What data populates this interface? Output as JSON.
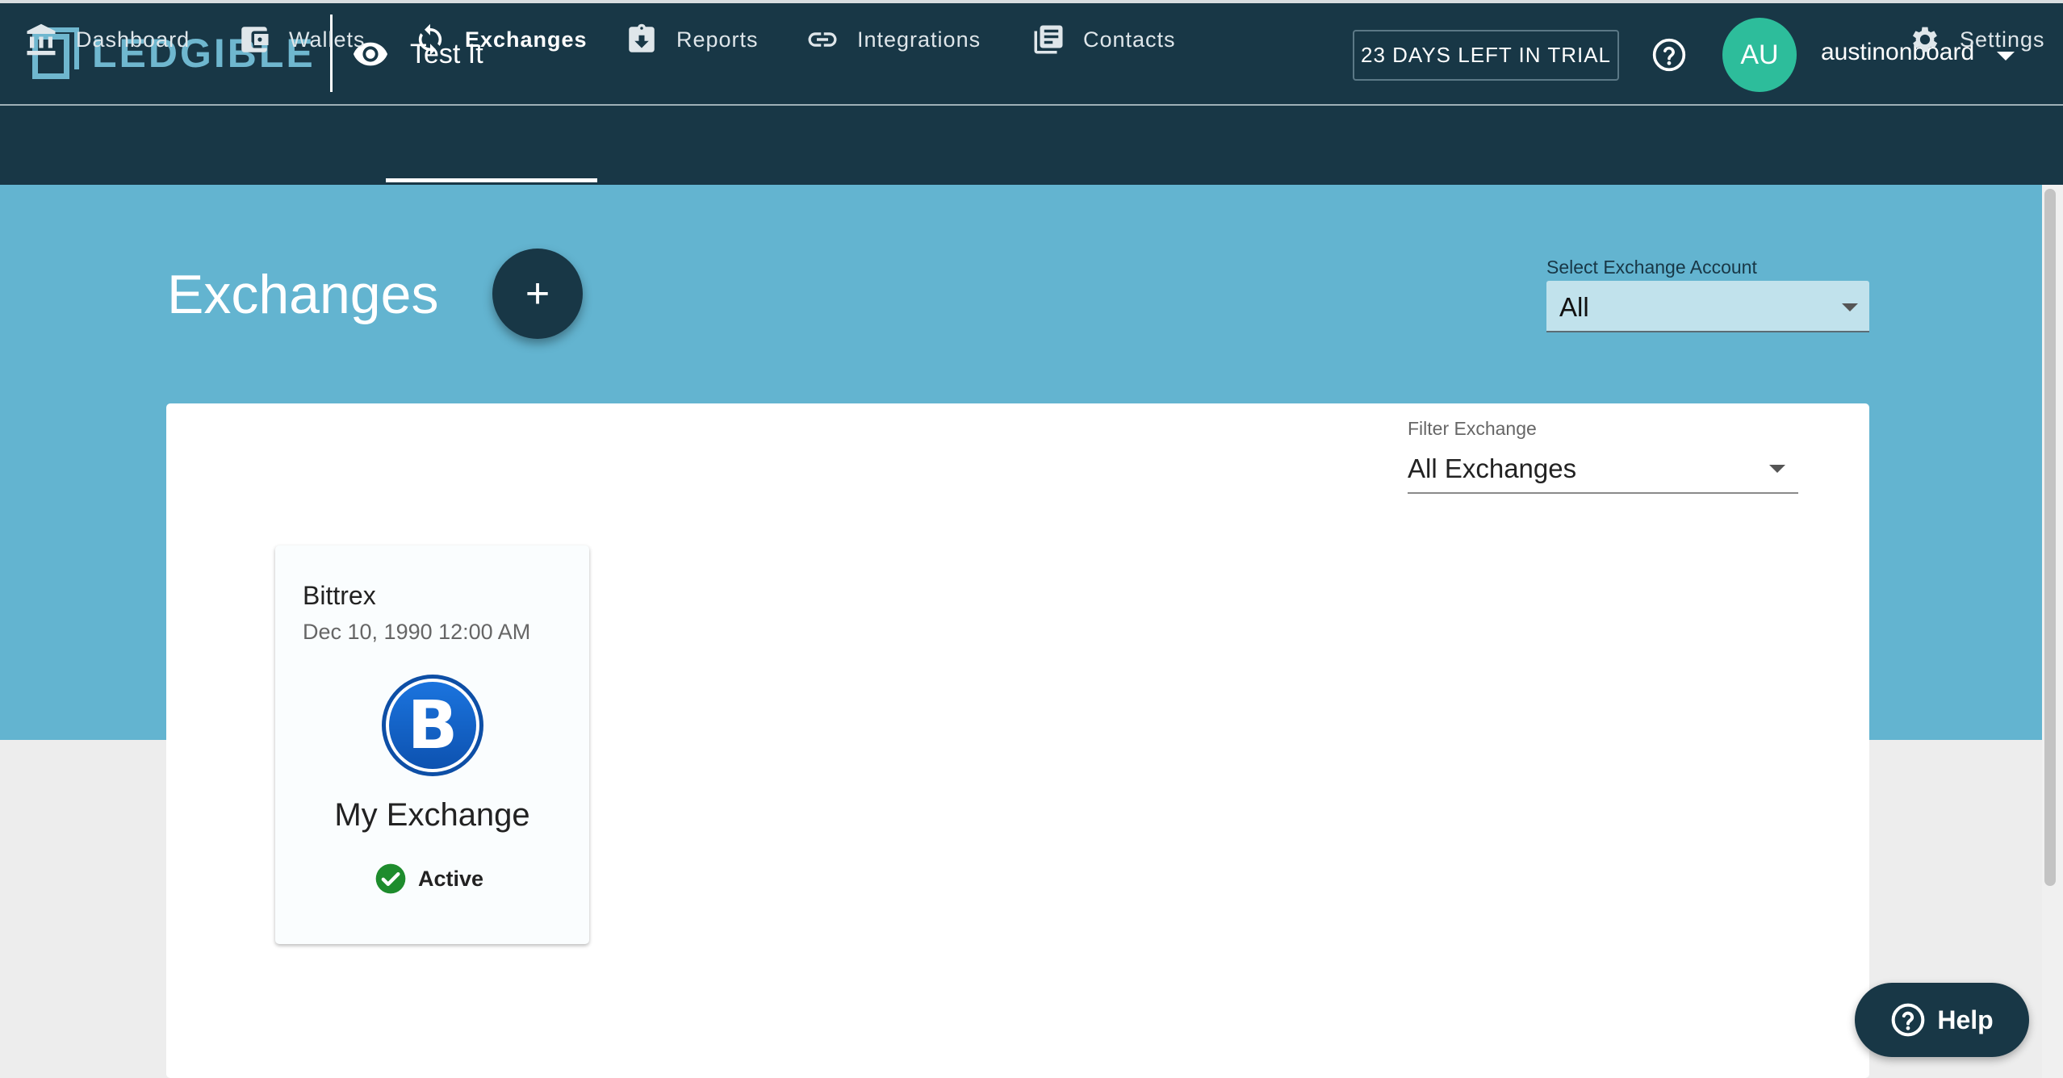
{
  "header": {
    "logo_text": "LEDGIBLE",
    "view_mode_label": "Test It",
    "trial_text": "23 DAYS LEFT IN TRIAL",
    "avatar_initials": "AU",
    "username": "austinonboard"
  },
  "nav": {
    "items": [
      {
        "label": "Dashboard",
        "icon": "bank-icon"
      },
      {
        "label": "Wallets",
        "icon": "wallet-icon"
      },
      {
        "label": "Exchanges",
        "icon": "sync-icon",
        "active": true
      },
      {
        "label": "Reports",
        "icon": "clipboard-download-icon"
      },
      {
        "label": "Integrations",
        "icon": "link-icon"
      },
      {
        "label": "Contacts",
        "icon": "contacts-icon"
      }
    ],
    "settings_label": "Settings"
  },
  "page": {
    "title": "Exchanges",
    "add_button": "+",
    "account_select_label": "Select Exchange Account",
    "account_select_value": "All",
    "filter_label": "Filter Exchange",
    "filter_value": "All Exchanges"
  },
  "cards": [
    {
      "exchange": "Bittrex",
      "date": "Dec 10, 1990 12:00 AM",
      "logo_letter": "B",
      "name": "My Exchange",
      "status": "Active"
    }
  ],
  "help_button": "Help",
  "colors": {
    "header_bg": "#183746",
    "hero_bg": "#63b4d0",
    "brand": "#6fb7cf",
    "avatar": "#2dbd9b",
    "status_ok": "#1e8c2d",
    "bittrex_blue": "#1161c9"
  }
}
